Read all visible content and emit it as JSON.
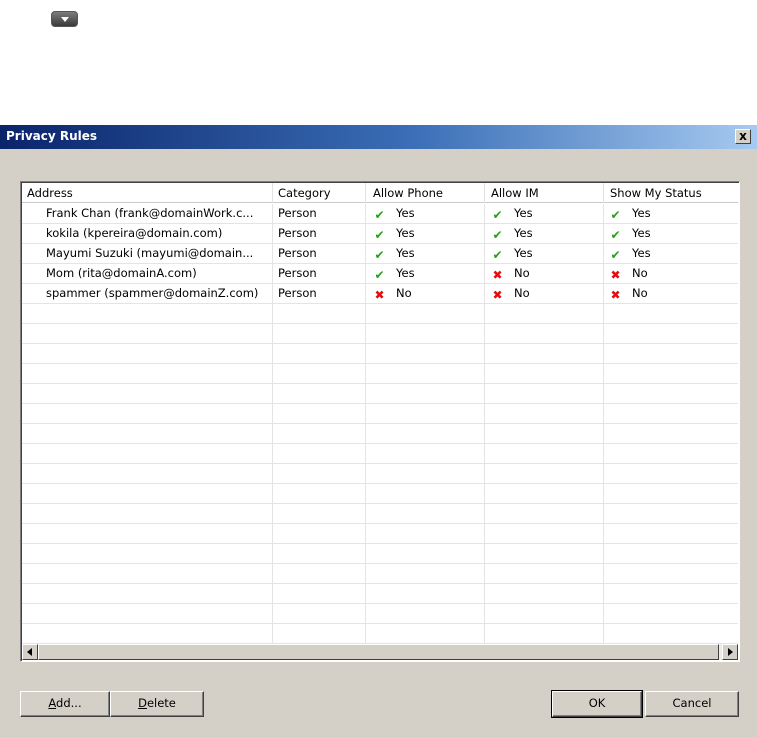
{
  "dialog": {
    "title": "Privacy Rules",
    "close_label": "x"
  },
  "table": {
    "headers": [
      "Address",
      "Category",
      "Allow Phone",
      "Allow IM",
      "Show My Status"
    ],
    "rows": [
      {
        "address": "Frank Chan (frank@domainWork.c...",
        "category": "Person",
        "phone": "Yes",
        "im": "Yes",
        "status": "Yes"
      },
      {
        "address": "kokila (kpereira@domain.com)",
        "category": "Person",
        "phone": "Yes",
        "im": "Yes",
        "status": "Yes"
      },
      {
        "address": "Mayumi Suzuki (mayumi@domain...",
        "category": "Person",
        "phone": "Yes",
        "im": "Yes",
        "status": "Yes"
      },
      {
        "address": "Mom (rita@domainA.com)",
        "category": "Person",
        "phone": "Yes",
        "im": "No",
        "status": "No"
      },
      {
        "address": "spammer (spammer@domainZ.com)",
        "category": "Person",
        "phone": "No",
        "im": "No",
        "status": "No"
      }
    ],
    "icons": {
      "yes": "check-icon",
      "no": "cross-icon"
    },
    "colors": {
      "yes": "#2a9d1f",
      "no": "#e01010"
    }
  },
  "buttons": {
    "add_prefix": "A",
    "add_rest": "dd...",
    "delete_prefix": "D",
    "delete_rest": "elete",
    "ok": "OK",
    "cancel": "Cancel"
  }
}
